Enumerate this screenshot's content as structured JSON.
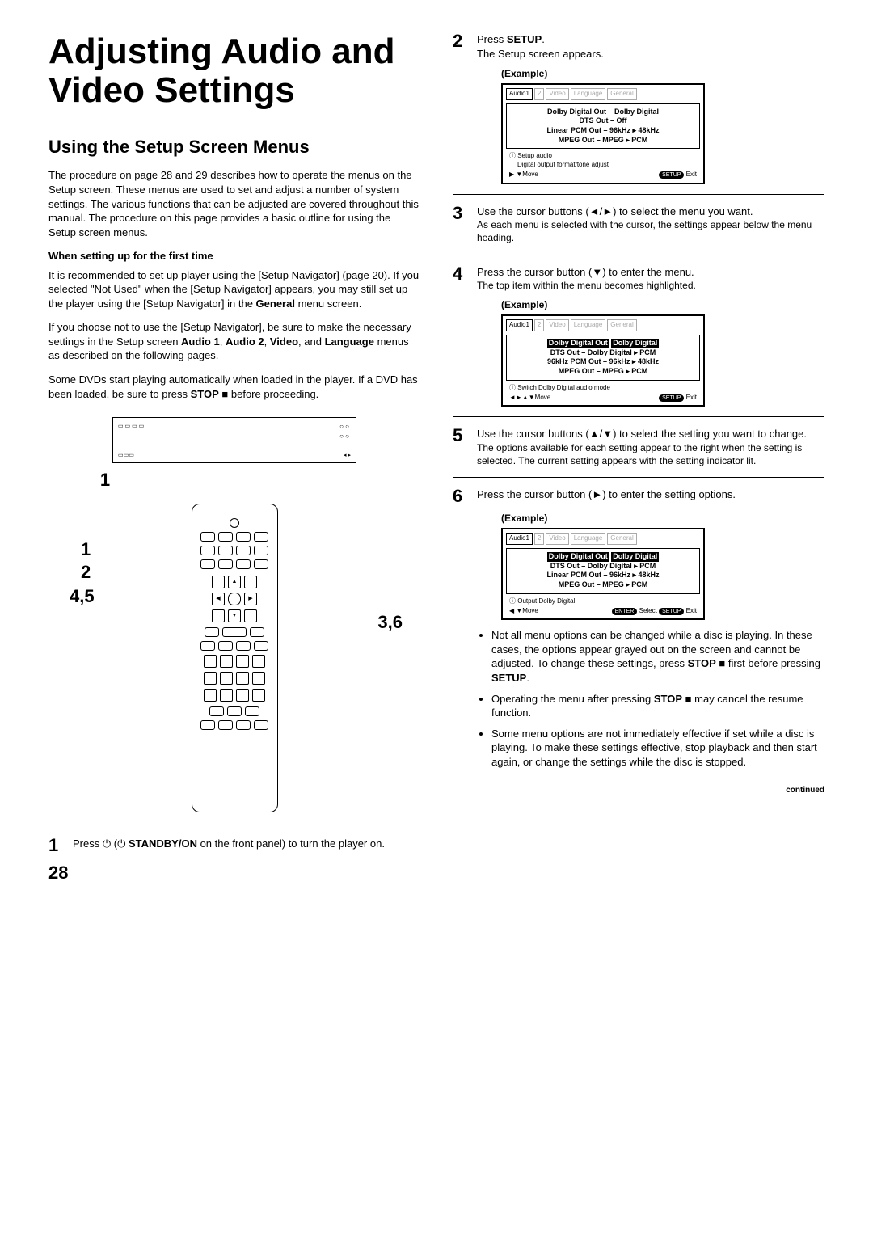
{
  "title": "Adjusting Audio and Video Settings",
  "section_title": "Using the Setup Screen Menus",
  "intro_para": "The procedure on page 28 and 29 describes how to operate the menus on the Setup screen. These menus are used to set and adjust a number of system settings. The various functions that can be adjusted are covered throughout this manual. The procedure on this page provides a basic outline for using the Setup screen menus.",
  "first_time_heading": "When setting up for the first time",
  "first_time_p1a": "It is recommended to set up player using the [Setup Navigator] (page 20). If you selected \"Not Used\" when the [Setup Navigator] appears, you may still set up the player using the [Setup Navigator] in the ",
  "first_time_p1_bold": "General",
  "first_time_p1b": " menu screen.",
  "first_time_p2a": "If you choose not to use the [Setup Navigator], be sure to make the necessary settings in the Setup screen ",
  "first_time_p2_bold": "Audio 1",
  "first_time_p2_c": ", ",
  "first_time_p2_bold2": "Audio 2",
  "first_time_p2_c2": ", ",
  "first_time_p2_bold3": "Video",
  "first_time_p2_c3": ", and ",
  "first_time_p2_bold4": "Language",
  "first_time_p2_end": " menus as described on the following pages.",
  "dvd_note_a": "Some DVDs start playing automatically when loaded in the player. If a DVD has been loaded, be sure to press ",
  "dvd_note_bold": "STOP",
  "dvd_note_b": " ■ before proceeding.",
  "callout_1": "1",
  "callout_2": "2",
  "callout_45": "4,5",
  "callout_36": "3,6",
  "step1_num": "1",
  "step1_a": "Press ⏻ (⏻ ",
  "step1_bold": "STANDBY/ON",
  "step1_b": " on the front panel) to turn the player on.",
  "step2_num": "2",
  "step2_a": "Press ",
  "step2_bold": "SETUP",
  "step2_b": ".",
  "step2_sub": "The Setup screen appears.",
  "example_label": "(Example)",
  "osd1": {
    "tab1": "Audio1",
    "tab2": "2",
    "tab3": "Video",
    "tab4": "Language",
    "tab5": "General",
    "l1": "Dolby Digital Out – Dolby Digital",
    "l2": "DTS Out – Off",
    "l3": "Linear PCM Out – 96kHz ▸ 48kHz",
    "l4": "MPEG Out – MPEG ▸ PCM",
    "info1": "ⓘ Setup audio",
    "info2": "Digital output format/tone adjust",
    "foot_move": "Move",
    "foot_setup": "SETUP",
    "foot_exit": "Exit"
  },
  "step3_num": "3",
  "step3_main": "Use the cursor buttons (◄/►) to select the menu you want.",
  "step3_sub": "As each menu is selected with the cursor, the settings appear below the menu heading.",
  "step4_num": "4",
  "step4_main": "Press the cursor button (▼) to enter the menu.",
  "step4_sub": "The top item within the menu becomes highlighted.",
  "osd2": {
    "l1a": "Dolby Digital Out",
    "l1b": "Dolby Digital",
    "l2": "DTS Out – Dolby Digital ▸ PCM",
    "l3": "96kHz PCM Out – 96kHz ▸ 48kHz",
    "l4": "MPEG Out – MPEG ▸ PCM",
    "info": "ⓘ Switch Dolby Digital audio mode",
    "nav": "◄►▲▼",
    "foot_move": "Move",
    "foot_setup": "SETUP",
    "foot_exit": "Exit"
  },
  "step5_num": "5",
  "step5_main": "Use the cursor buttons (▲/▼) to select the setting you want to change.",
  "step5_sub": "The options available for each setting appear to the right when the setting is selected. The current setting appears with the setting indicator lit.",
  "step6_num": "6",
  "step6_main": "Press the cursor button (►) to enter the setting options.",
  "osd3": {
    "l1a": "Dolby Digital Out",
    "l1b": "Dolby Digital",
    "l2": "DTS Out – Dolby Digital ▸ PCM",
    "l3": "Linear PCM Out – 96kHz ▸ 48kHz",
    "l4": "MPEG Out – MPEG ▸ PCM",
    "info": "ⓘ Output Dolby Digital",
    "foot_move": "Move",
    "foot_enter": "ENTER",
    "foot_select": "Select",
    "foot_setup": "SETUP",
    "foot_exit": "Exit"
  },
  "note1a": "Not all menu options can be changed while a disc is playing. In these cases, the options appear grayed out on the screen and cannot be adjusted. To change these settings, press ",
  "note1_bold1": "STOP",
  "note1b": " ■ first before pressing ",
  "note1_bold2": "SETUP",
  "note1c": ".",
  "note2a": "Operating the menu after pressing ",
  "note2_bold": "STOP",
  "note2b": " ■ may cancel the resume function.",
  "note3": "Some menu options are not immediately effective if set while a disc is playing. To make these settings effective, stop playback and then start again, or change the settings while the disc is stopped.",
  "page_number": "28",
  "continued": "continued"
}
